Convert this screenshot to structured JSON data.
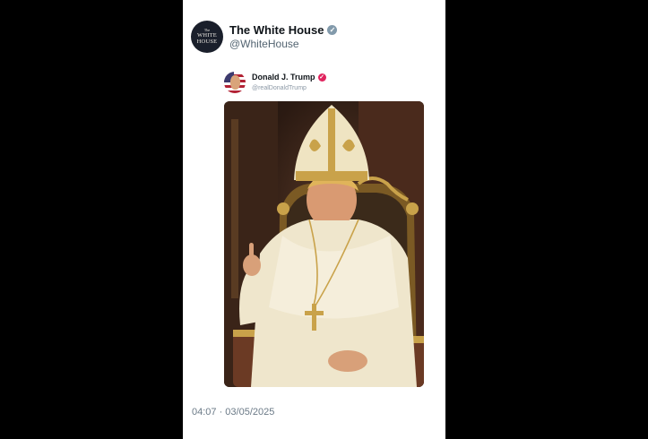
{
  "post": {
    "account": {
      "name": "The White House",
      "handle": "@WhiteHouse",
      "avatar_text": {
        "line1": "The",
        "line2": "WHITE",
        "line3": "HOUSE"
      },
      "verified_badge_color": "#829aab"
    },
    "timestamp": "04:07 · 03/05/2025"
  },
  "quoted_post": {
    "name": "Donald J. Trump",
    "handle": "@realDonaldTrump",
    "verified_badge_color": "#e0245e"
  },
  "colors": {
    "page_background": "#000000",
    "card_background": "#ffffff",
    "vestment": "#f1ead2",
    "gold": "#c9a24a"
  }
}
